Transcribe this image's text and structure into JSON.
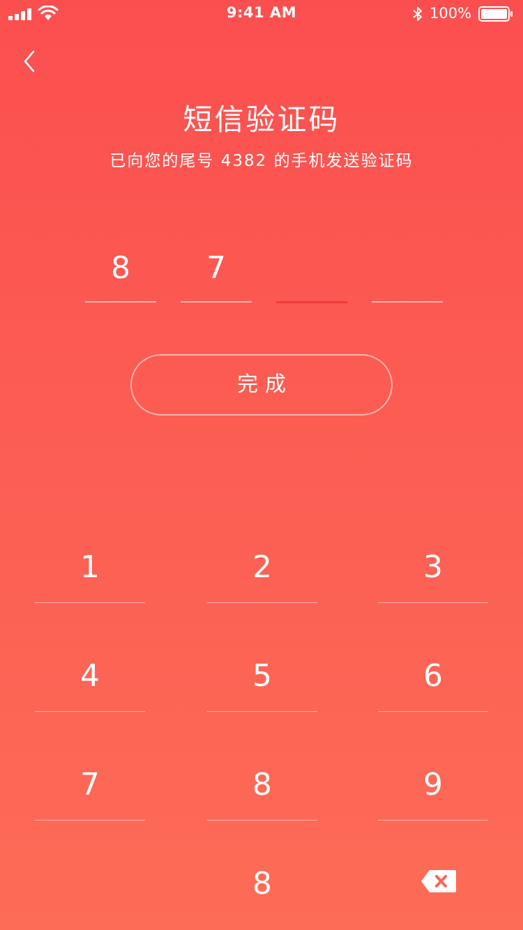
{
  "status_bar": {
    "time": "9:41 AM",
    "battery": "100%",
    "icons": [
      "signal-icon",
      "wifi-icon",
      "bluetooth-icon",
      "battery-icon"
    ]
  },
  "header": {
    "back_icon": "chevron-left-icon",
    "title": "短信验证码",
    "subtitle": "已向您的尾号 4382 的手机发送验证码"
  },
  "code": {
    "digits": [
      "8",
      "7",
      "",
      ""
    ],
    "active_index": 2
  },
  "done_button": {
    "label": "完成"
  },
  "keypad": {
    "keys": [
      "1",
      "2",
      "3",
      "4",
      "5",
      "6",
      "7",
      "8",
      "9"
    ],
    "zero_key": "8",
    "delete_icon": "backspace-icon"
  },
  "colors": {
    "gradient_top": "#fb4f4f",
    "gradient_bottom": "#fd6c57",
    "active_underline": "#ee3b3b",
    "text": "#ffffff"
  }
}
